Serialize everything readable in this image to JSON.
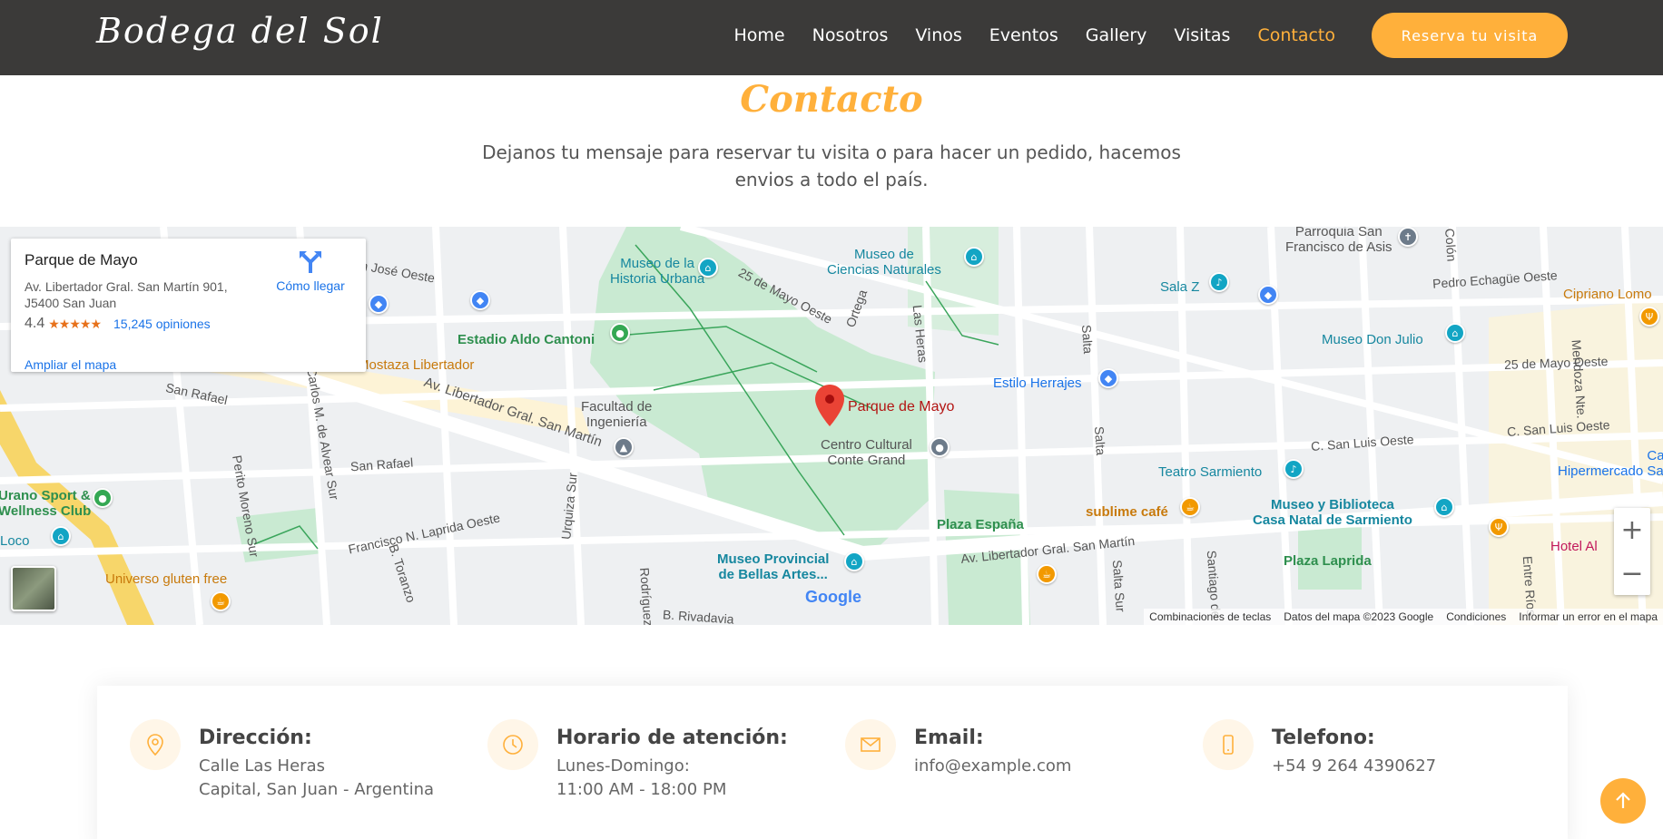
{
  "header": {
    "logo": "Bodega del Sol",
    "nav": [
      "Home",
      "Nosotros",
      "Vinos",
      "Eventos",
      "Gallery",
      "Visitas",
      "Contacto"
    ],
    "active_nav": "Contacto",
    "cta": "Reserva tu visita"
  },
  "contact": {
    "title": "Contacto",
    "description": "Dejanos tu mensaje para reservar tu visita o para hacer un pedido, hacemos envios a todo el país."
  },
  "map": {
    "card": {
      "place": "Parque de Mayo",
      "address": "Av. Libertador Gral. San Martín 901, J5400 San Juan",
      "rating": "4.4",
      "stars": "★★★★★",
      "reviews": "15,245 opiniones",
      "directions": "Cómo llegar",
      "enlarge": "Ampliar el mapa"
    },
    "marker_label": "Parque de Mayo",
    "places": {
      "museo_historia": "Museo de la\nHistoria Urbana",
      "museo_ciencias": "Museo de\nCiencias Naturales",
      "estadio": "Estadio Aldo Cantoni",
      "facultad": "Facultad de\nIngeniería",
      "centro_cultural": "Centro Cultural\nConte Grand",
      "estilo_herrajes": "Estilo Herrajes",
      "plaza_espana": "Plaza España",
      "teatro_sarmiento": "Teatro Sarmiento",
      "sublime": "sublime café",
      "museo_biblioteca": "Museo y Biblioteca\nCasa Natal de Sarmiento",
      "plaza_laprida": "Plaza Laprida",
      "museo_bellas": "Museo Provincial\nde Bellas Artes...",
      "parroquia": "Parroquia San\nFrancisco de Asis",
      "sala_z": "Sala Z",
      "museo_julio": "Museo Don Julio",
      "cipriano": "Cipriano Lomo",
      "carrefour": "Carrefour\nHipermercado San Juan",
      "mostaza": "Mostaza Libertador",
      "universo": "Universo gluten free",
      "urano": "Urano Sport &\nWellness Club",
      "loco": "Loco",
      "hotel": "Hotel Al"
    },
    "streets": {
      "mayo_oeste": "25 de Mayo Oeste",
      "mayo_oeste_right": "25 de Mayo Oeste",
      "libertador": "Av. Libertador Gral. San Martín",
      "libertador_right": "Av. Libertador Gral. San Martín",
      "san_rafael": "San Rafael",
      "san_rafael_2": "San Rafael",
      "san_jose": "San José Oeste",
      "laprida": "Francisco N. Laprida Oeste",
      "perito": "Perito Moreno Sur",
      "alvear": "Carlos M. de Alvear Sur",
      "toranzo": "B. Toranzo",
      "urquiza": "Urquiza Sur",
      "ortega": "Ortega",
      "las_heras": "Las Heras",
      "salta": "Salta",
      "salta_2": "Salta",
      "salta_sur": "Salta Sur",
      "santiago": "Santiago de",
      "san_luis": "C. San Luis Oeste",
      "san_luis_2": "C. San Luis Oeste",
      "echague": "Pedro Echagüe Oeste",
      "mendoza": "Mendoza Nte.",
      "colon": "Colón",
      "entre_rios": "Entre Ríos",
      "rivadavia": "B. Rivadavia",
      "rodriguez": "Rodríguez"
    },
    "google": "Google",
    "attribution": [
      "Combinaciones de teclas",
      "Datos del mapa ©2023 Google",
      "Condiciones",
      "Informar un error en el mapa"
    ],
    "zoom_in": "+",
    "zoom_out": "−"
  },
  "info": {
    "address": {
      "title": "Dirección:",
      "line1": "Calle Las Heras",
      "line2": "Capital, San Juan - Argentina"
    },
    "hours": {
      "title": "Horario de atención:",
      "line1": "Lunes-Domingo:",
      "line2": "11:00 AM - 18:00 PM"
    },
    "email": {
      "title": "Email:",
      "line1": "info@example.com"
    },
    "phone": {
      "title": "Telefono:",
      "line1": "+54 9 264 4390627"
    }
  },
  "colors": {
    "accent": "#ffb03b",
    "header_bg": "#3b3a39"
  }
}
